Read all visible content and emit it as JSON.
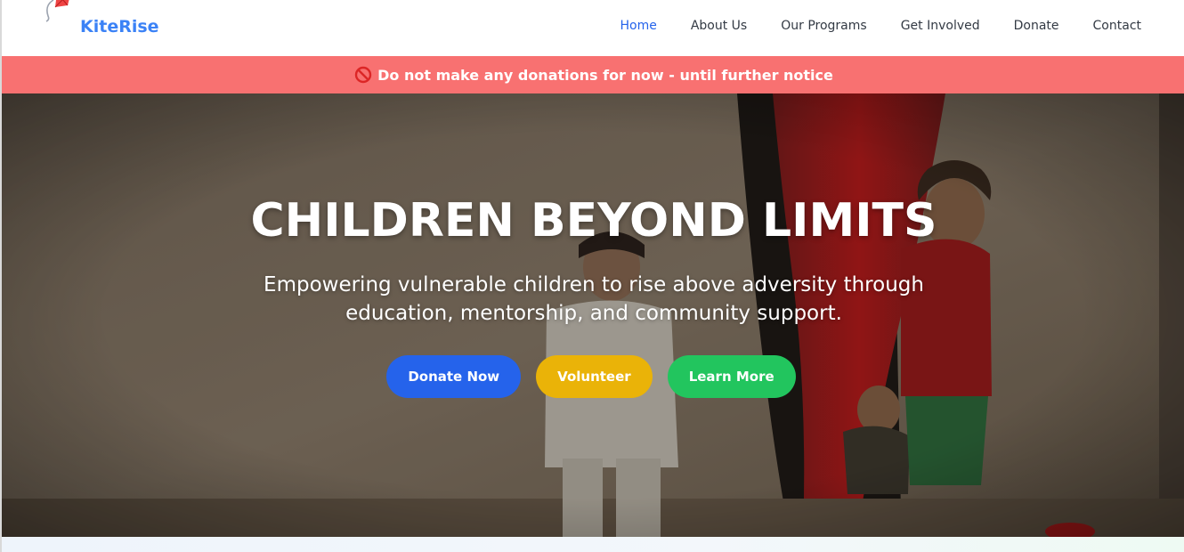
{
  "header": {
    "brand": "KiteRise",
    "logo_icon": "kite-icon",
    "nav": [
      {
        "label": "Home",
        "active": true
      },
      {
        "label": "About Us",
        "active": false
      },
      {
        "label": "Our Programs",
        "active": false
      },
      {
        "label": "Get Involved",
        "active": false
      },
      {
        "label": "Donate",
        "active": false
      },
      {
        "label": "Contact",
        "active": false
      }
    ]
  },
  "notice": {
    "icon": "prohibited-icon",
    "text": "Do not make any donations for now - until further notice"
  },
  "hero": {
    "title": "CHILDREN BEYOND LIMITS",
    "subtitle": "Empowering vulnerable children to rise above adversity through education, mentorship, and community support.",
    "buttons": {
      "donate": "Donate Now",
      "volunteer": "Volunteer",
      "learn": "Learn More"
    }
  },
  "colors": {
    "brand": "#3b82f6",
    "nav_active": "#2563eb",
    "notice_bg": "#f87171",
    "donate_button": "#2563eb",
    "volunteer_button": "#eab308",
    "learn_button": "#22c55e"
  }
}
